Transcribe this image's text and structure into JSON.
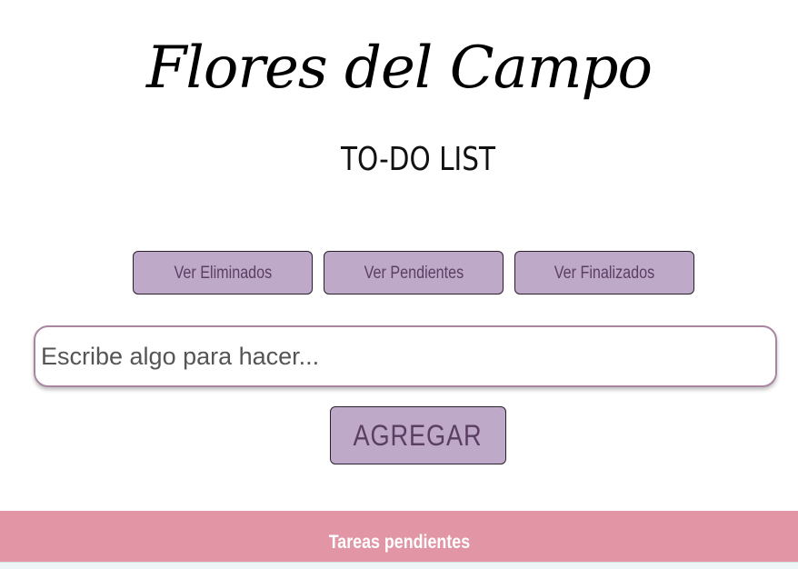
{
  "header": {
    "brand": "Flores del Campo",
    "subtitle": "TO-DO LIST"
  },
  "filters": {
    "deleted_label": "Ver Eliminados",
    "pending_label": "Ver Pendientes",
    "finished_label": "Ver Finalizados"
  },
  "task_input": {
    "value": "",
    "placeholder": "Escribe algo para hacer..."
  },
  "add_button": {
    "label": "AGREGAR"
  },
  "pending_section": {
    "title": "Tareas pendientes"
  },
  "colors": {
    "button_bg": "#bfa9c9",
    "button_text": "#5b3f63",
    "input_border": "#a9869f",
    "section_header_bg": "#e195a5"
  }
}
